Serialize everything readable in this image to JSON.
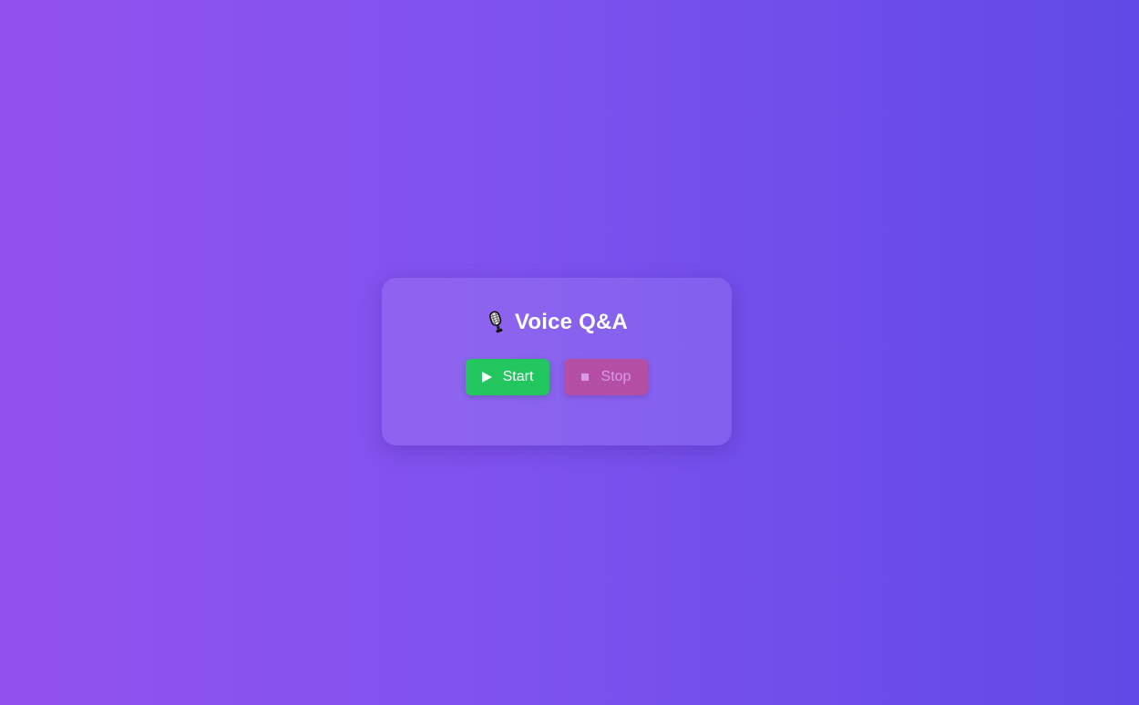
{
  "app": {
    "title": "Voice Q&A",
    "title_icon": "microphone-icon"
  },
  "controls": {
    "start": {
      "label": "Start",
      "icon": "play-icon",
      "color": "#22c55e"
    },
    "stop": {
      "label": "Stop",
      "icon": "stop-icon",
      "color": "#b54fa6",
      "disabled": true
    }
  },
  "colors": {
    "background_start": "#9352ef",
    "background_end": "#6049e6"
  }
}
